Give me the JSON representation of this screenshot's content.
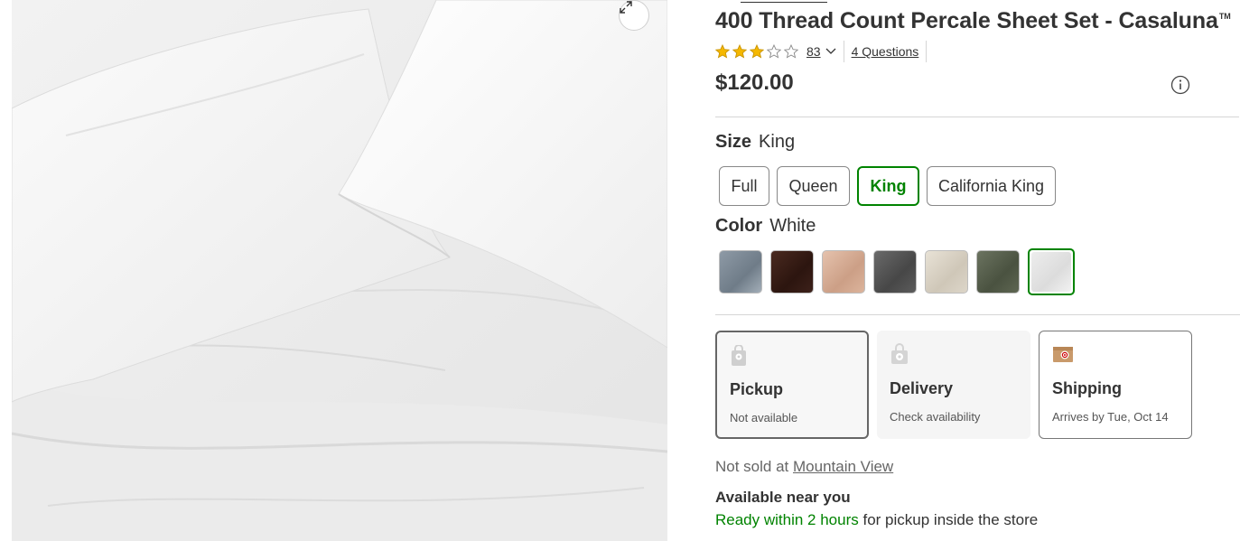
{
  "product": {
    "title": "400 Thread Count Percale Sheet Set - Casaluna",
    "trademark": "TM",
    "rating_value": 3,
    "rating_max": 5,
    "rating_count": "83",
    "questions_link": "4 Questions",
    "price": "$120.00"
  },
  "size": {
    "label": "Size",
    "selected": "King",
    "options": [
      "Full",
      "Queen",
      "King",
      "California King"
    ]
  },
  "color": {
    "label": "Color",
    "selected": "White",
    "swatches": [
      "blue-gray",
      "dark-brown",
      "blush",
      "charcoal",
      "cream",
      "olive",
      "white"
    ]
  },
  "fulfillment": {
    "pickup": {
      "title": "Pickup",
      "status": "Not available"
    },
    "delivery": {
      "title": "Delivery",
      "status": "Check availability"
    },
    "shipping": {
      "title": "Shipping",
      "status": "Arrives by Tue, Oct 14"
    }
  },
  "store": {
    "not_sold_prefix": "Not sold at",
    "store_name": "Mountain View",
    "available_heading": "Available near you",
    "ready_green": "Ready within 2 hours",
    "ready_rest": "for pickup inside the store"
  },
  "colors": {
    "accent_green": "#008300",
    "star_gold": "#f5b800",
    "text": "#333333"
  }
}
